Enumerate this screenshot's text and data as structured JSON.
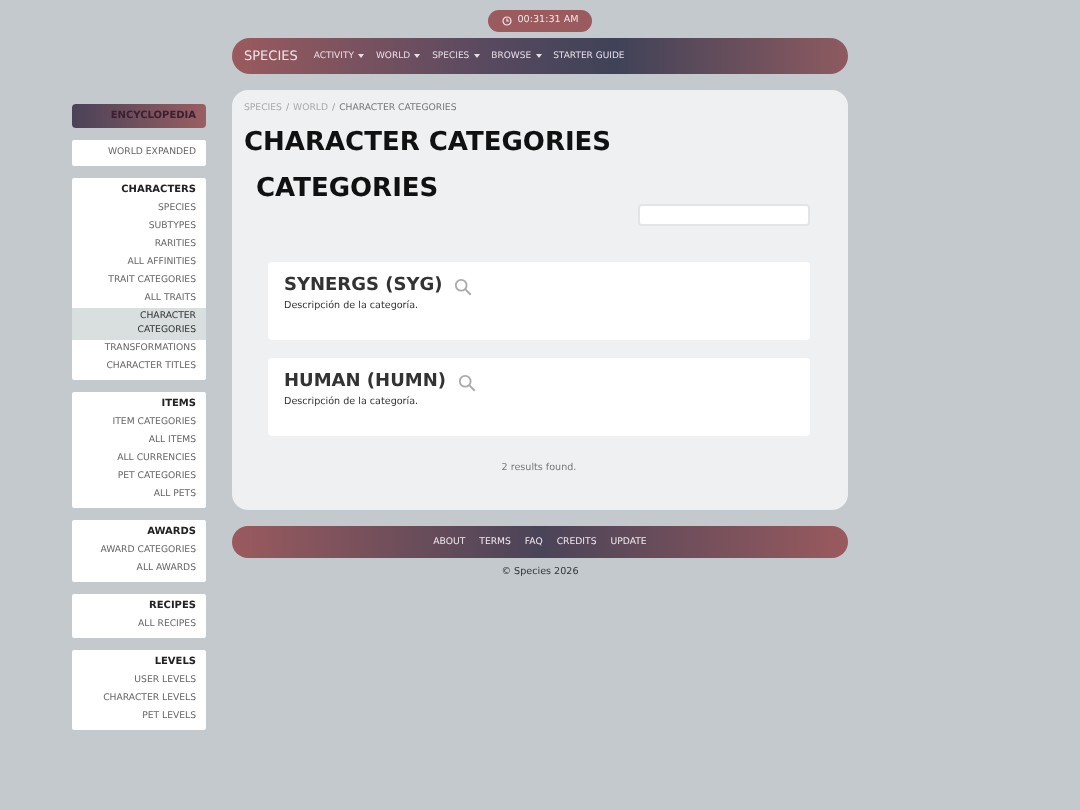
{
  "clock": {
    "time": "00:31:31 AM"
  },
  "nav": {
    "brand": "SPECIES",
    "items": [
      {
        "label": "ACTIVITY",
        "has_menu": true
      },
      {
        "label": "WORLD",
        "has_menu": true
      },
      {
        "label": "SPECIES",
        "has_menu": true
      },
      {
        "label": "BROWSE",
        "has_menu": true
      },
      {
        "label": "STARTER GUIDE",
        "has_menu": false
      }
    ]
  },
  "sidebar": {
    "header": "ENCYCLOPEDIA",
    "groups": [
      {
        "items": [
          {
            "label": "WORLD EXPANDED",
            "selected": false
          }
        ]
      },
      {
        "title": "CHARACTERS",
        "items": [
          {
            "label": "SPECIES",
            "selected": false
          },
          {
            "label": "SUBTYPES",
            "selected": false
          },
          {
            "label": "RARITIES",
            "selected": false
          },
          {
            "label": "ALL AFFINITIES",
            "selected": false
          },
          {
            "label": "TRAIT CATEGORIES",
            "selected": false
          },
          {
            "label": "ALL TRAITS",
            "selected": false
          },
          {
            "label": "CHARACTER CATEGORIES",
            "selected": true
          },
          {
            "label": "TRANSFORMATIONS",
            "selected": false
          },
          {
            "label": "CHARACTER TITLES",
            "selected": false
          }
        ]
      },
      {
        "title": "ITEMS",
        "items": [
          {
            "label": "ITEM CATEGORIES",
            "selected": false
          },
          {
            "label": "ALL ITEMS",
            "selected": false
          },
          {
            "label": "ALL CURRENCIES",
            "selected": false
          },
          {
            "label": "PET CATEGORIES",
            "selected": false
          },
          {
            "label": "ALL PETS",
            "selected": false
          }
        ]
      },
      {
        "title": "AWARDS",
        "items": [
          {
            "label": "AWARD CATEGORIES",
            "selected": false
          },
          {
            "label": "ALL AWARDS",
            "selected": false
          }
        ]
      },
      {
        "title": "RECIPES",
        "items": [
          {
            "label": "ALL RECIPES",
            "selected": false
          }
        ]
      },
      {
        "title": "LEVELS",
        "items": [
          {
            "label": "USER LEVELS",
            "selected": false
          },
          {
            "label": "CHARACTER LEVELS",
            "selected": false
          },
          {
            "label": "PET LEVELS",
            "selected": false
          }
        ]
      }
    ]
  },
  "breadcrumb": {
    "separator": "/",
    "crumbs": [
      "SPECIES",
      "WORLD",
      "CHARACTER CATEGORIES"
    ]
  },
  "title": "CHARACTER CATEGORIES",
  "subtitle": "CATEGORIES",
  "categories": [
    {
      "name": "SYNERGS (SYG)",
      "description": "Descripción de la categoría."
    },
    {
      "name": "HUMAN (HUMN)",
      "description": "Descripción de la categoría."
    }
  ],
  "results": "2 results found.",
  "footer": {
    "links": [
      "ABOUT",
      "TERMS",
      "FAQ",
      "CREDITS",
      "UPDATE"
    ],
    "copyright": "© Species 2026"
  }
}
